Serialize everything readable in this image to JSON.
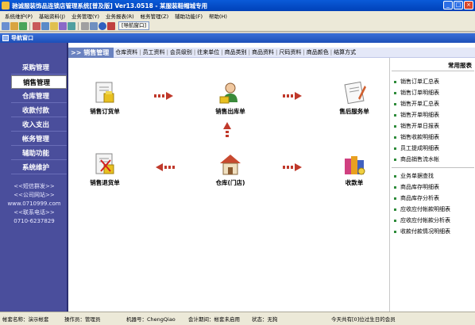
{
  "window": {
    "title": "驰诚服装饰品连锁店管理系统[普及版] Ver13.0518 - 某服装鞋帽城专用"
  },
  "menu": [
    "系统维护(P)",
    "基础资料(J)",
    "业务管理(Y)",
    "业务报表(R)",
    "帐务管理(Z)",
    "辅助功能(F)",
    "帮助(H)"
  ],
  "toolbar": {
    "nav_button": "[导航窗口]"
  },
  "nav_window": {
    "label": "导航窗口"
  },
  "sidebar": {
    "items": [
      {
        "label": "采购管理",
        "active": false
      },
      {
        "label": "销售管理",
        "active": true
      },
      {
        "label": "仓库管理",
        "active": false
      },
      {
        "label": "收款付款",
        "active": false
      },
      {
        "label": "收入支出",
        "active": false
      },
      {
        "label": "帐务管理",
        "active": false
      },
      {
        "label": "辅助功能",
        "active": false
      },
      {
        "label": "系统维护",
        "active": false
      }
    ],
    "links": [
      "<<短信群发>>",
      "<<公司网站>>",
      "www.0710999.com",
      "<<联系电话>>",
      "0710-6237829"
    ]
  },
  "main": {
    "section_title": ">> 销售管理",
    "tabs": [
      "仓库资料",
      "员工资料",
      "会员级别",
      "往来单位",
      "商品类别",
      "商品资料",
      "尺码资料",
      "商品颜色",
      "结算方式"
    ]
  },
  "workflow": {
    "sales_order": "销售订货单",
    "sales_out": "销售出库单",
    "after_sales": "售后服务单",
    "sales_return": "销售退货单",
    "warehouse": "仓库(门店)",
    "receipt": "收款单"
  },
  "reports": {
    "title": "常用报表",
    "group1": [
      "销售订单汇总表",
      "销售订单明细表",
      "销售开单汇总表",
      "销售开单明细表",
      "销售开单日报表",
      "销售收款明细表",
      "员工提成明细表",
      "商品销售流水帐"
    ],
    "group2": [
      "业务单据查找",
      "商品库存明细表",
      "商品库存分析表",
      "应收应付帐款明细表",
      "应收应付帐款分析表",
      "收款付款情况明细表"
    ]
  },
  "status": {
    "account": "帐套名称：演示帐套",
    "operator": "操作员：管理员",
    "machine": "机器号：ChengQiao",
    "period": "会计期间：帐套未启用",
    "state": "状态：无狗",
    "birthday": "今天共有[0]位过生日的会员"
  },
  "colors": {
    "sidebar": "#4a4e9c",
    "arrow": "#c0392b",
    "title_bar": "#0a5ad8"
  }
}
